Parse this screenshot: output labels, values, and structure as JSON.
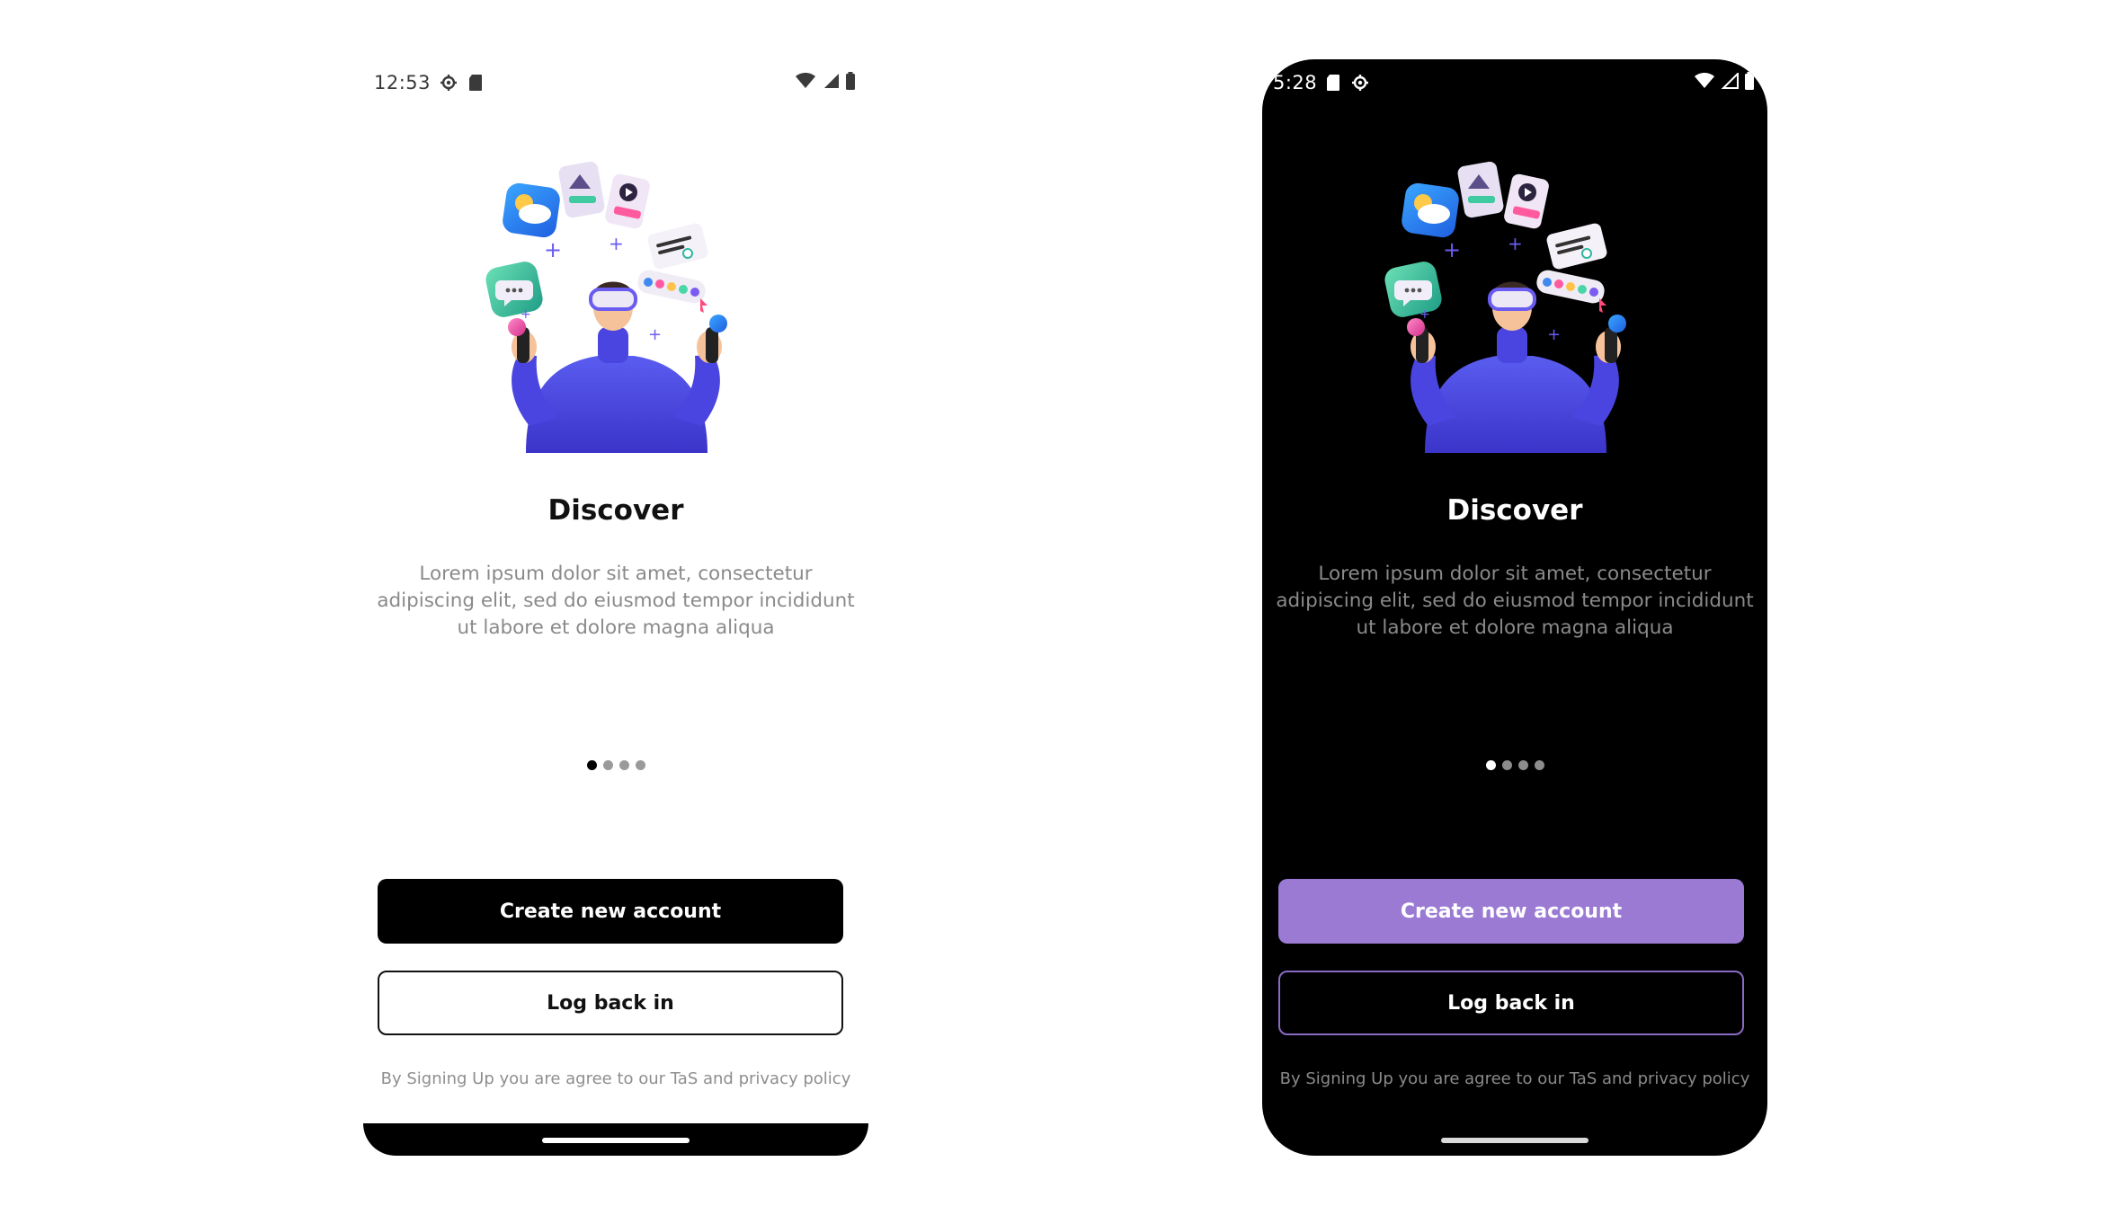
{
  "screens": [
    {
      "theme": "light",
      "status": {
        "time": "12:53"
      },
      "title": "Discover",
      "description": "Lorem ipsum dolor sit amet, consectetur adipiscing elit, sed do eiusmod tempor incididunt ut labore et dolore magna aliqua",
      "pagination": {
        "current": 1,
        "total": 4
      },
      "primary_button": "Create new account",
      "secondary_button": "Log back in",
      "terms": "By Signing Up you are agree to our TaS and privacy policy"
    },
    {
      "theme": "dark",
      "status": {
        "time": "5:28"
      },
      "title": "Discover",
      "description": "Lorem ipsum dolor sit amet, consectetur adipiscing elit, sed do eiusmod tempor incididunt ut labore et dolore magna aliqua",
      "pagination": {
        "current": 1,
        "total": 4
      },
      "primary_button": "Create new account",
      "secondary_button": "Log back in",
      "terms": "By Signing Up you are agree to our TaS and privacy policy"
    }
  ],
  "colors": {
    "accent_dark_theme": "#9b7ad4",
    "primary_light_theme": "#000000",
    "muted_text": "#8a8a8a"
  },
  "icons": {
    "status_left": [
      "settings-gear-icon",
      "sd-card-icon"
    ],
    "status_right": [
      "wifi-icon",
      "cellular-signal-icon",
      "battery-icon"
    ]
  }
}
